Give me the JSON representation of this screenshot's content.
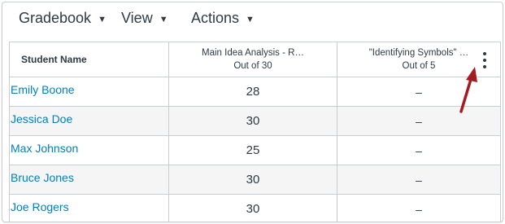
{
  "menubar": {
    "gradebook_label": "Gradebook",
    "view_label": "View",
    "actions_label": "Actions"
  },
  "grid": {
    "header": {
      "student_col": "Student Name",
      "assignment1": {
        "title": "Main Idea Analysis - R…",
        "points": "Out of 30"
      },
      "assignment2": {
        "title": "\"Identifying Symbols\" …",
        "points": "Out of 5"
      }
    },
    "rows": [
      {
        "name": "Emily Boone",
        "score1": "28",
        "score2": "–"
      },
      {
        "name": "Jessica Doe",
        "score1": "30",
        "score2": "–"
      },
      {
        "name": "Max Johnson",
        "score1": "25",
        "score2": "–"
      },
      {
        "name": "Bruce Jones",
        "score1": "30",
        "score2": "–"
      },
      {
        "name": "Joe Rogers",
        "score1": "30",
        "score2": "–"
      }
    ]
  },
  "colors": {
    "link": "#0081bd",
    "text": "#2d3b45",
    "annotation_arrow": "#a11d21"
  }
}
